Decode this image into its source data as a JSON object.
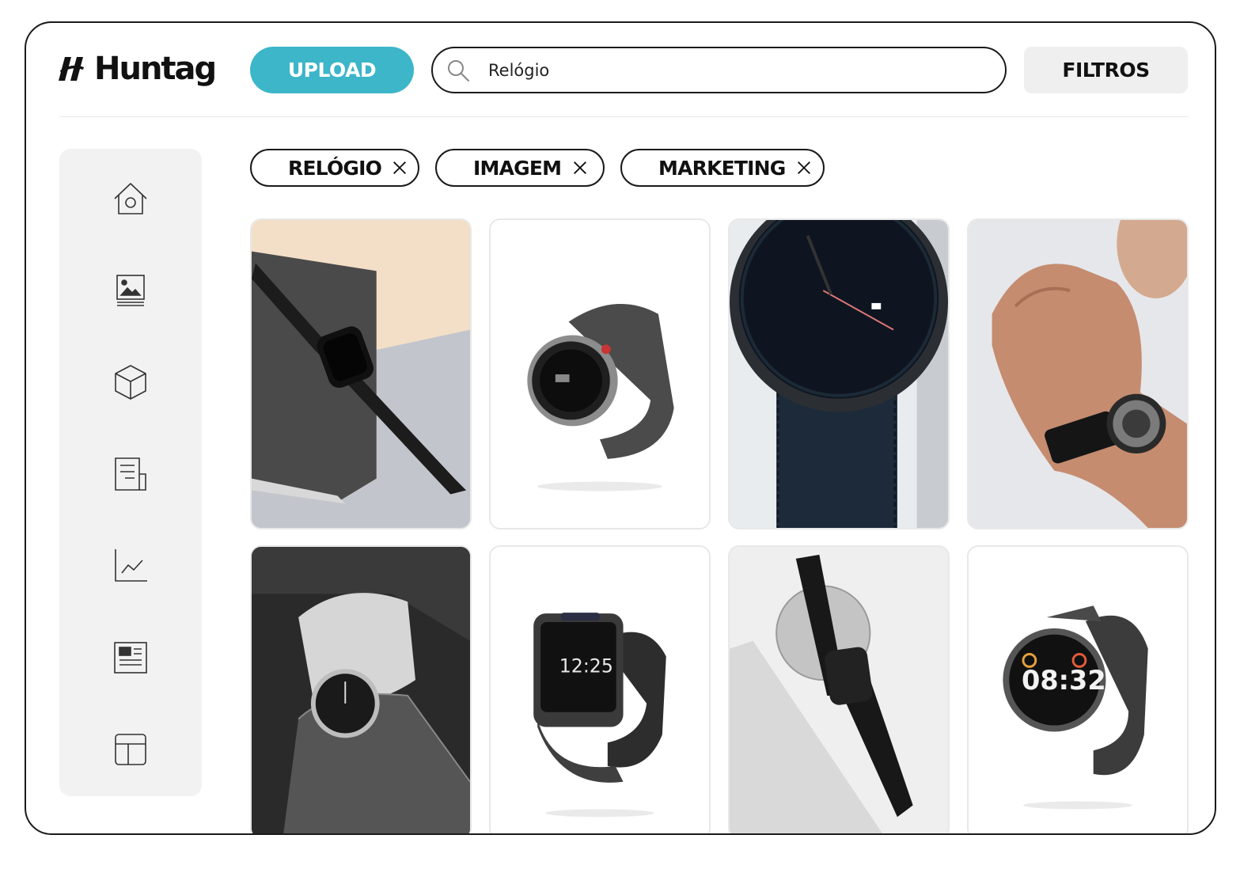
{
  "header": {
    "logo_text": "Huntag",
    "upload_label": "UPLOAD",
    "search_value": "Relógio",
    "filters_label": "FILTROS"
  },
  "sidebar": {
    "items": [
      {
        "icon": "home-icon"
      },
      {
        "icon": "image-library-icon"
      },
      {
        "icon": "cube-icon"
      },
      {
        "icon": "document-icon"
      },
      {
        "icon": "chart-icon"
      },
      {
        "icon": "news-icon"
      },
      {
        "icon": "layout-icon"
      }
    ]
  },
  "active_filters": [
    {
      "label": "RELÓGIO"
    },
    {
      "label": "IMAGEM"
    },
    {
      "label": "MARKETING"
    }
  ],
  "results": [
    {
      "subject": "black smartwatch on notebook"
    },
    {
      "subject": "round grey smartwatch"
    },
    {
      "subject": "analog watch close-up"
    },
    {
      "subject": "man wearing skeleton watch"
    },
    {
      "subject": "black and white wrist watch"
    },
    {
      "subject": "square smartwatch showing 12:25"
    },
    {
      "subject": "smartwatch on glass sphere"
    },
    {
      "subject": "round smartwatch showing 08:32"
    }
  ],
  "colors": {
    "accent": "#3cb6c8",
    "text": "#111111",
    "panel": "#f2f2f2"
  }
}
